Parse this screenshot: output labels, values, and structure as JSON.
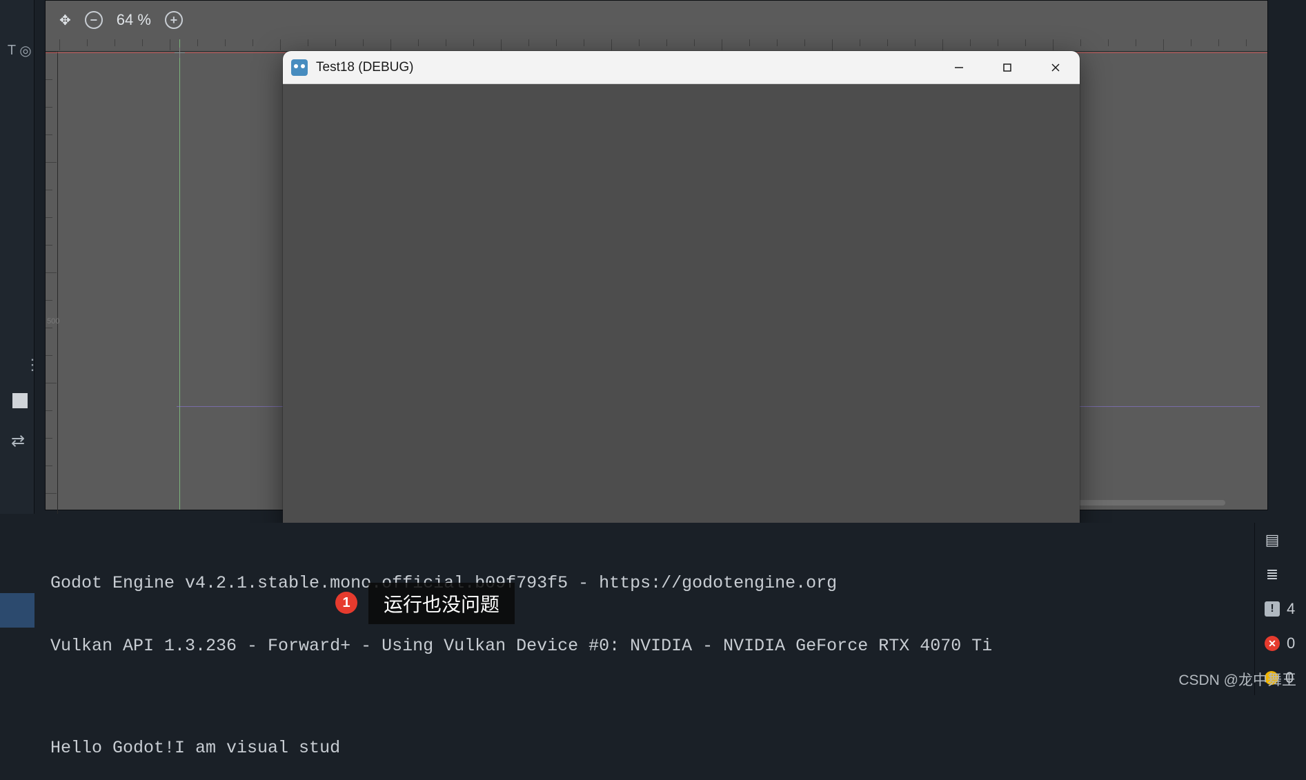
{
  "viewport": {
    "zoom_label": "64 %",
    "ruler_label_v": "500"
  },
  "game_window": {
    "title": "Test18 (DEBUG)"
  },
  "console": {
    "lines": [
      "Godot Engine v4.2.1.stable.mono.official.b09f793f5 - https://godotengine.org",
      "Vulkan API 1.3.236 - Forward+ - Using Vulkan Device #0: NVIDIA - NVIDIA GeForce RTX 4070 Ti",
      "",
      "Hello Godot!I am visual stud"
    ]
  },
  "annotation": {
    "badge": "1",
    "text": "运行也没问题"
  },
  "right_panel": {
    "warn_count": "4",
    "err_count": "0",
    "yellow_count": "0"
  },
  "watermark": "CSDN @龙中舞王"
}
